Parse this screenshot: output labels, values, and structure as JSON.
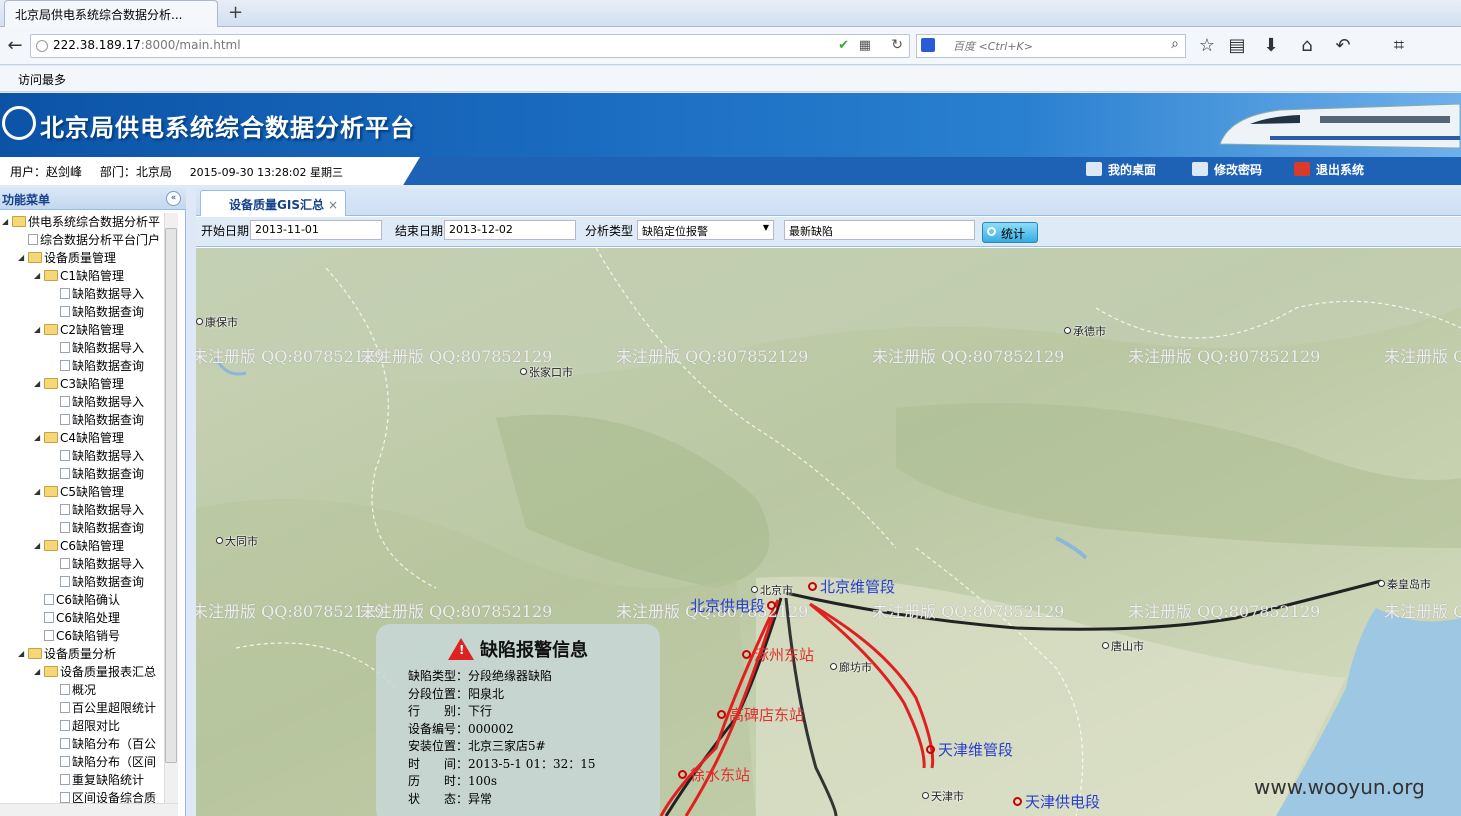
{
  "browser": {
    "tab_title": "北京局供电系统综合数据分析...",
    "new_tab": "+",
    "url_host": "222.38.189.17",
    "url_rest": ":8000/main.html",
    "search_placeholder": "百度 <Ctrl+K>",
    "bookmark": "访问最多"
  },
  "app": {
    "title": "北京局供电系统综合数据分析平台",
    "user": "用户：赵剑峰",
    "dept": "部门：北京局",
    "datetime": "2015-09-30 13:28:02 星期三",
    "btn_desktop": "我的桌面",
    "btn_password": "修改密码",
    "btn_logout": "退出系统"
  },
  "sidebar": {
    "title": "功能菜单",
    "collapse": "«",
    "items": [
      {
        "label": "供电系统综合数据分析平",
        "level": 0,
        "type": "folder",
        "arrow": "◢"
      },
      {
        "label": "综合数据分析平台门户",
        "level": 1,
        "type": "file"
      },
      {
        "label": "设备质量管理",
        "level": 1,
        "type": "folder",
        "arrow": "◢"
      },
      {
        "label": "C1缺陷管理",
        "level": 2,
        "type": "folder",
        "arrow": "◢"
      },
      {
        "label": "缺陷数据导入",
        "level": 3,
        "type": "file"
      },
      {
        "label": "缺陷数据查询",
        "level": 3,
        "type": "file"
      },
      {
        "label": "C2缺陷管理",
        "level": 2,
        "type": "folder",
        "arrow": "◢"
      },
      {
        "label": "缺陷数据导入",
        "level": 3,
        "type": "file"
      },
      {
        "label": "缺陷数据查询",
        "level": 3,
        "type": "file"
      },
      {
        "label": "C3缺陷管理",
        "level": 2,
        "type": "folder",
        "arrow": "◢"
      },
      {
        "label": "缺陷数据导入",
        "level": 3,
        "type": "file"
      },
      {
        "label": "缺陷数据查询",
        "level": 3,
        "type": "file"
      },
      {
        "label": "C4缺陷管理",
        "level": 2,
        "type": "folder",
        "arrow": "◢"
      },
      {
        "label": "缺陷数据导入",
        "level": 3,
        "type": "file"
      },
      {
        "label": "缺陷数据查询",
        "level": 3,
        "type": "file"
      },
      {
        "label": "C5缺陷管理",
        "level": 2,
        "type": "folder",
        "arrow": "◢"
      },
      {
        "label": "缺陷数据导入",
        "level": 3,
        "type": "file"
      },
      {
        "label": "缺陷数据查询",
        "level": 3,
        "type": "file"
      },
      {
        "label": "C6缺陷管理",
        "level": 2,
        "type": "folder",
        "arrow": "◢"
      },
      {
        "label": "缺陷数据导入",
        "level": 3,
        "type": "file"
      },
      {
        "label": "缺陷数据查询",
        "level": 3,
        "type": "file"
      },
      {
        "label": "C6缺陷确认",
        "level": 2,
        "type": "file"
      },
      {
        "label": "C6缺陷处理",
        "level": 2,
        "type": "file"
      },
      {
        "label": "C6缺陷销号",
        "level": 2,
        "type": "file"
      },
      {
        "label": "设备质量分析",
        "level": 1,
        "type": "folder",
        "arrow": "◢"
      },
      {
        "label": "设备质量报表汇总",
        "level": 2,
        "type": "folder",
        "arrow": "◢"
      },
      {
        "label": "概况",
        "level": 3,
        "type": "file"
      },
      {
        "label": "百公里超限统计",
        "level": 3,
        "type": "file"
      },
      {
        "label": "超限对比",
        "level": 3,
        "type": "file"
      },
      {
        "label": "缺陷分布（百公",
        "level": 3,
        "type": "file"
      },
      {
        "label": "缺陷分布（区间",
        "level": 3,
        "type": "file"
      },
      {
        "label": "重复缺陷统计",
        "level": 3,
        "type": "file"
      },
      {
        "label": "区间设备综合质",
        "level": 3,
        "type": "file"
      }
    ]
  },
  "main": {
    "tab_label": "设备质量GIS汇总",
    "tab_close": "×",
    "start_label": "开始日期",
    "start_value": "2013-11-01",
    "end_label": "结束日期",
    "end_value": "2013-12-02",
    "type_label": "分析类型",
    "type_value": "缺陷定位报警",
    "latest_value": "最新缺陷",
    "stat_button": "统计"
  },
  "map": {
    "cities": [
      {
        "name": "康保市"
      },
      {
        "name": "承德市"
      },
      {
        "name": "张家口市"
      },
      {
        "name": "大同市"
      },
      {
        "name": "北京市"
      },
      {
        "name": "秦皇岛市"
      },
      {
        "name": "唐山市"
      },
      {
        "name": "廊坊市"
      },
      {
        "name": "天津市"
      }
    ],
    "watermark": "未注册版 QQ:807852129",
    "stations": [
      {
        "name": "北京维管段",
        "color": "blue"
      },
      {
        "name": "北京供电段",
        "color": "blue"
      },
      {
        "name": "涿州东站",
        "color": "red"
      },
      {
        "name": "高碑店东站",
        "color": "red"
      },
      {
        "name": "徐水东站",
        "color": "red"
      },
      {
        "name": "天津维管段",
        "color": "blue"
      },
      {
        "name": "天津供电段",
        "color": "blue"
      }
    ]
  },
  "alert": {
    "title": "缺陷报警信息",
    "rows": [
      "缺陷类型：分段绝缘器缺陷",
      "分段位置：阳泉北",
      "行　　别：下行",
      "设备编号：000002",
      "安装位置：北京三家店5#",
      "时　　间：2013-5-1 01：32：15",
      "历　　时：100s",
      "状　　态：异常"
    ]
  },
  "footer_watermark": "www.wooyun.org"
}
